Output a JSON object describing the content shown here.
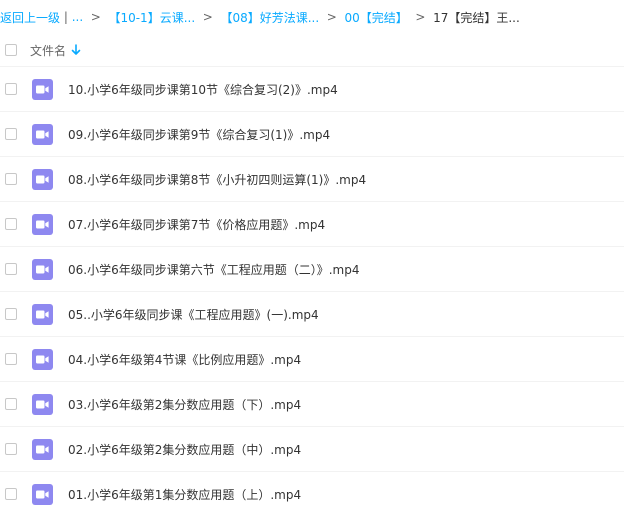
{
  "breadcrumb": {
    "back": "返回上一级",
    "ellipsis": "...",
    "crumbs": [
      "【10-1】云课...",
      "【08】好芳法课...",
      "00【完结】"
    ],
    "current": "17【完结】王..."
  },
  "header": {
    "column_name": "文件名"
  },
  "files": [
    {
      "name": "10.小学6年级同步课第10节《综合复习(2)》.mp4",
      "icon": "video-file-icon"
    },
    {
      "name": "09.小学6年级同步课第9节《综合复习(1)》.mp4",
      "icon": "video-file-icon"
    },
    {
      "name": "08.小学6年级同步课第8节《小升初四则运算(1)》.mp4",
      "icon": "video-file-icon"
    },
    {
      "name": "07.小学6年级同步课第7节《价格应用题》.mp4",
      "icon": "video-file-icon"
    },
    {
      "name": "06.小学6年级同步课第六节《工程应用题（二）》.mp4",
      "icon": "video-file-icon"
    },
    {
      "name": "05..小学6年级同步课《工程应用题》(一).mp4",
      "icon": "video-file-icon"
    },
    {
      "name": "04.小学6年级第4节课《比例应用题》.mp4",
      "icon": "video-file-icon"
    },
    {
      "name": "03.小学6年级第2集分数应用题（下）.mp4",
      "icon": "video-file-icon"
    },
    {
      "name": "02.小学6年级第2集分数应用题（中）.mp4",
      "icon": "video-file-icon"
    },
    {
      "name": "01.小学6年级第1集分数应用题（上）.mp4",
      "icon": "video-file-icon"
    }
  ],
  "colors": {
    "link": "#09aaff",
    "video_icon": "#8e88f0"
  }
}
